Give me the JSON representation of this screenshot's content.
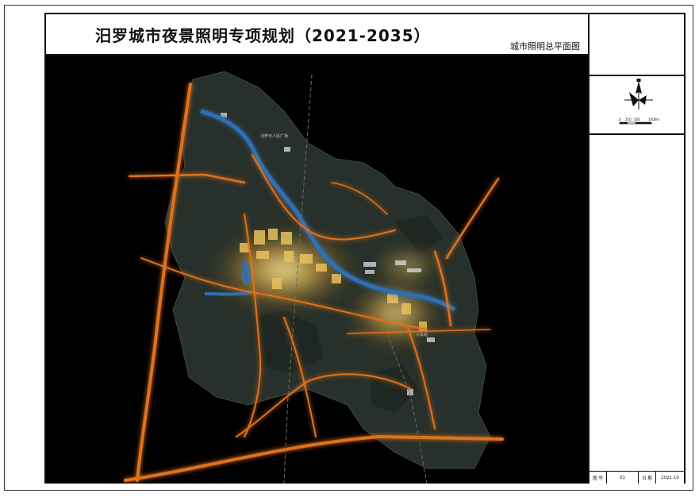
{
  "header": {
    "title": "汨罗城市夜景照明专项规划（2021-2035）",
    "subtitle": "城市照明总平面图"
  },
  "legend": {
    "scale_labels": [
      "0",
      "250",
      "500",
      "1000m"
    ]
  },
  "title_block": {
    "drawing_no_label": "图 号",
    "drawing_no_value": "01",
    "date_label": "日 期",
    "date_value": "2021.10"
  },
  "map": {
    "place_labels": [
      "汨罗市人民广场",
      "火车站"
    ],
    "colors": {
      "background": "#000000",
      "terrain": "#2a332c",
      "road_glow": "#e0711c",
      "river": "#2f6fb3",
      "district_light": "#f0c85a"
    }
  }
}
